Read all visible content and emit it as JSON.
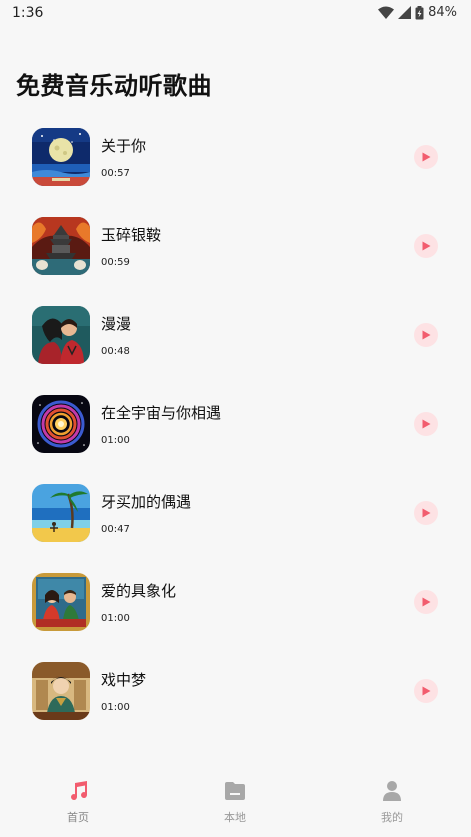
{
  "status_bar": {
    "time": "1:36",
    "battery": "84%"
  },
  "page": {
    "title": "免费音乐动听歌曲"
  },
  "songs": [
    {
      "title": "关于你",
      "duration": "00:57",
      "cover": "moon-night-cover"
    },
    {
      "title": "玉碎银鞍",
      "duration": "00:59",
      "cover": "pagoda-fire-cover"
    },
    {
      "title": "漫漫",
      "duration": "00:48",
      "cover": "couple-cover"
    },
    {
      "title": "在全宇宙与你相遇",
      "duration": "01:00",
      "cover": "cosmic-vortex-cover"
    },
    {
      "title": "牙买加的偶遇",
      "duration": "00:47",
      "cover": "beach-palm-cover"
    },
    {
      "title": "爱的具象化",
      "duration": "01:00",
      "cover": "couple-window-cover"
    },
    {
      "title": "戏中梦",
      "duration": "01:00",
      "cover": "opera-lady-cover"
    }
  ],
  "bottom_nav": {
    "items": [
      {
        "label": "首页",
        "icon": "music-note-icon",
        "active": true
      },
      {
        "label": "本地",
        "icon": "folder-icon",
        "active": false
      },
      {
        "label": "我的",
        "icon": "person-icon",
        "active": false
      }
    ]
  },
  "colors": {
    "accent": "#f25c6e",
    "play_bg": "#fde2e4",
    "inactive_icon": "#a8a8a8"
  }
}
